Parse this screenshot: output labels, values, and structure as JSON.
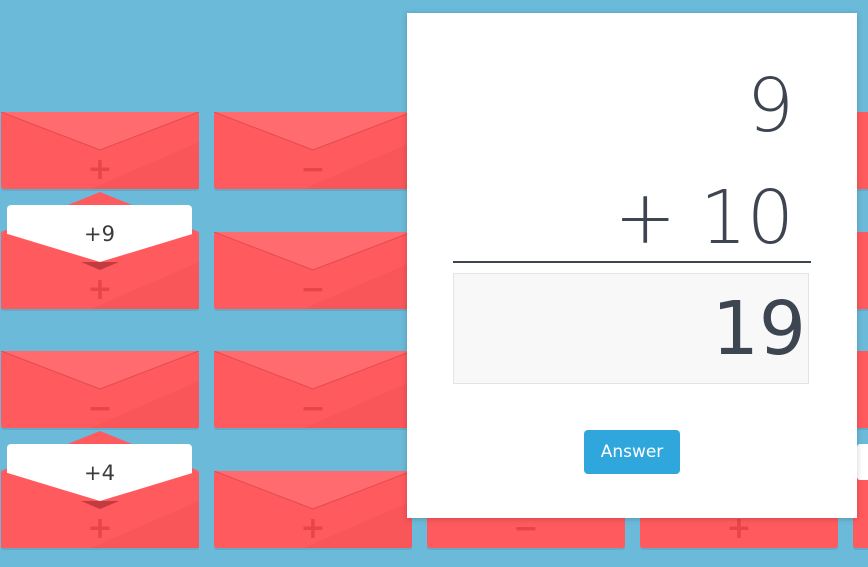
{
  "envelopes": [
    {
      "symbol": "+",
      "card": ""
    },
    {
      "symbol": "−",
      "card": ""
    },
    {
      "symbol": "+",
      "card": "+9"
    },
    {
      "symbol": "−",
      "card": ""
    },
    {
      "symbol": "−",
      "card": ""
    },
    {
      "symbol": "−",
      "card": ""
    },
    {
      "symbol": "+",
      "card": "+4"
    },
    {
      "symbol": "+",
      "card": ""
    },
    {
      "symbol": "−",
      "card": ""
    },
    {
      "symbol": "+",
      "card": ""
    }
  ],
  "problem": {
    "first_number": "9",
    "second_line": "+ 10",
    "answer_value": "19"
  },
  "button": {
    "label": "Answer"
  },
  "colors": {
    "background": "#6bbad9",
    "envelope": "#ff5a5e",
    "button": "#2fa7dc",
    "text": "#3d4550"
  }
}
